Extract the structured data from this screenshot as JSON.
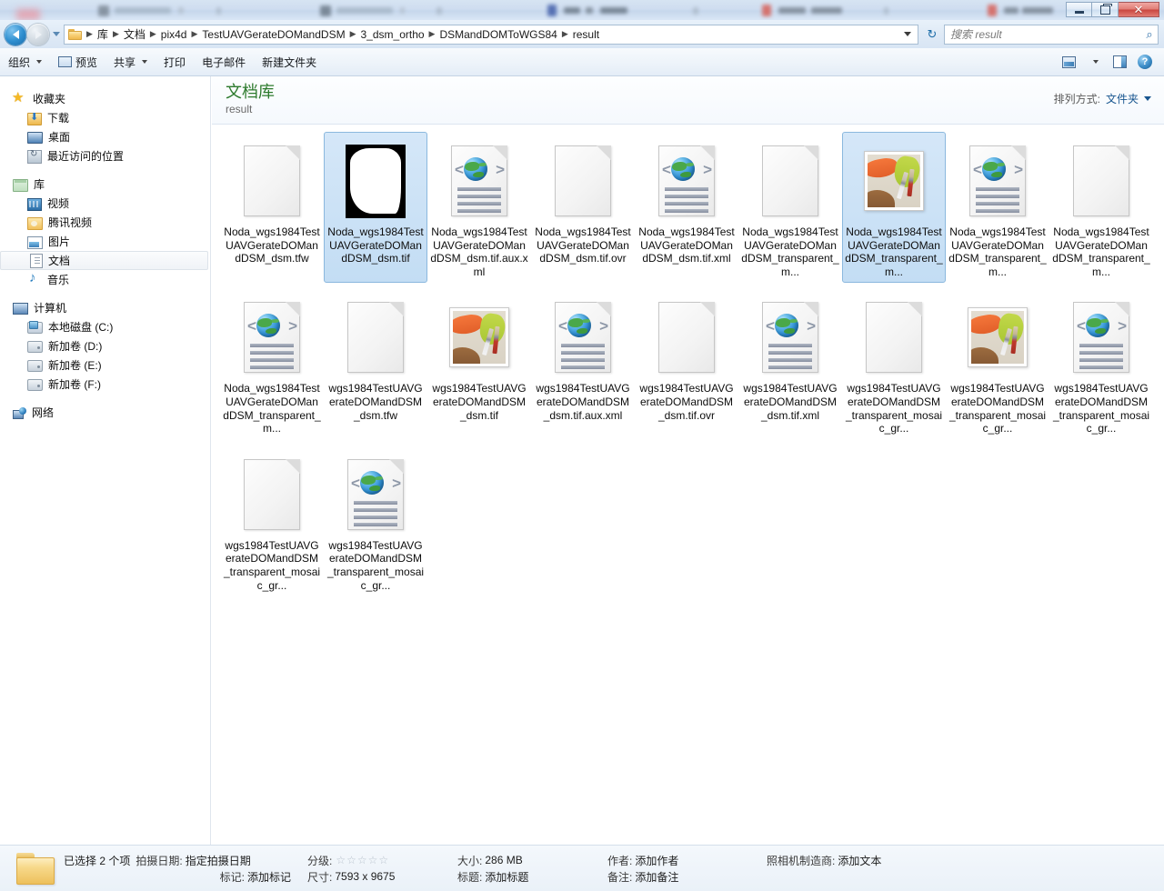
{
  "titlebar": {
    "minimize_label": "",
    "restore_label": "",
    "close_label": "✕"
  },
  "address_bar": {
    "back_icon": "back-arrow-icon",
    "forward_icon": "forward-arrow-icon",
    "recent_pages_icon": "chevron-down-icon",
    "breadcrumbs": [
      "库",
      "文档",
      "pix4d",
      "TestUAVGerateDOMandDSM",
      "3_dsm_ortho",
      "DSMandDOMToWGS84",
      "result"
    ],
    "dropdown_icon": "chevron-down-icon",
    "refresh_icon": "refresh-icon",
    "refresh_glyph": "↻",
    "search_placeholder": "搜索 result",
    "search_value": "",
    "search_icon": "search-icon",
    "search_glyph": "⌕"
  },
  "toolbar": {
    "items": [
      {
        "label": "组织",
        "has_caret": true,
        "icon": ""
      },
      {
        "label": "预览",
        "has_caret": false,
        "icon": "preview-icon"
      },
      {
        "label": "共享",
        "has_caret": true,
        "icon": ""
      },
      {
        "label": "打印",
        "has_caret": false,
        "icon": ""
      },
      {
        "label": "电子邮件",
        "has_caret": false,
        "icon": ""
      },
      {
        "label": "新建文件夹",
        "has_caret": false,
        "icon": ""
      }
    ],
    "right_buttons": [
      {
        "name": "change-view-button",
        "icon": "view-icon"
      },
      {
        "name": "change-view-dropdown",
        "icon": "chevron-down-icon"
      },
      {
        "name": "preview-pane-button",
        "icon": "preview-pane-icon"
      },
      {
        "name": "help-button",
        "icon": "help-icon",
        "glyph": "?"
      }
    ]
  },
  "sidebar": {
    "groups": [
      {
        "header": {
          "label": "收藏夹",
          "icon": "star-icon"
        },
        "items": [
          {
            "label": "下载",
            "icon": "download-icon"
          },
          {
            "label": "桌面",
            "icon": "desktop-icon"
          },
          {
            "label": "最近访问的位置",
            "icon": "recent-places-icon"
          }
        ]
      },
      {
        "header": {
          "label": "库",
          "icon": "library-icon"
        },
        "items": [
          {
            "label": "视频",
            "icon": "video-icon",
            "selected": false
          },
          {
            "label": "腾讯视频",
            "icon": "folder-icon",
            "selected": false
          },
          {
            "label": "图片",
            "icon": "pictures-icon",
            "selected": false
          },
          {
            "label": "文档",
            "icon": "documents-icon",
            "selected": true
          },
          {
            "label": "音乐",
            "icon": "music-icon",
            "selected": false
          }
        ]
      },
      {
        "header": {
          "label": "计算机",
          "icon": "computer-icon"
        },
        "items": [
          {
            "label": "本地磁盘 (C:)",
            "icon": "system-drive-icon"
          },
          {
            "label": "新加卷 (D:)",
            "icon": "drive-icon"
          },
          {
            "label": "新加卷 (E:)",
            "icon": "drive-icon"
          },
          {
            "label": "新加卷 (F:)",
            "icon": "drive-icon"
          }
        ]
      },
      {
        "header": {
          "label": "网络",
          "icon": "network-icon"
        },
        "items": []
      }
    ]
  },
  "library_header": {
    "title": "文档库",
    "subtitle": "result",
    "sort_label": "排列方式:",
    "sort_value": "文件夹",
    "sort_caret_icon": "chevron-down-icon"
  },
  "files": [
    {
      "name": "Noda_wgs1984TestUAVGerateDOMandDSM_dsm.tfw",
      "icon": "blank-file-icon",
      "selected": false
    },
    {
      "name": "Noda_wgs1984TestUAVGerateDOMandDSM_dsm.tif",
      "icon": "dsm-thumbnail-icon",
      "selected": true
    },
    {
      "name": "Noda_wgs1984TestUAVGerateDOMandDSM_dsm.tif.aux.xml",
      "icon": "xml-file-icon",
      "selected": false
    },
    {
      "name": "Noda_wgs1984TestUAVGerateDOMandDSM_dsm.tif.ovr",
      "icon": "blank-file-icon",
      "selected": false
    },
    {
      "name": "Noda_wgs1984TestUAVGerateDOMandDSM_dsm.tif.xml",
      "icon": "xml-file-icon",
      "selected": false
    },
    {
      "name": "Noda_wgs1984TestUAVGerateDOMandDSM_transparent_m...",
      "icon": "blank-file-icon",
      "selected": false
    },
    {
      "name": "Noda_wgs1984TestUAVGerateDOMandDSM_transparent_m...",
      "icon": "photo-thumbnail-icon",
      "selected": true
    },
    {
      "name": "Noda_wgs1984TestUAVGerateDOMandDSM_transparent_m...",
      "icon": "xml-file-icon",
      "selected": false
    },
    {
      "name": "Noda_wgs1984TestUAVGerateDOMandDSM_transparent_m...",
      "icon": "blank-file-icon",
      "selected": false
    },
    {
      "name": "Noda_wgs1984TestUAVGerateDOMandDSM_transparent_m...",
      "icon": "xml-file-icon",
      "selected": false
    },
    {
      "name": "wgs1984TestUAVGerateDOMandDSM_dsm.tfw",
      "icon": "blank-file-icon",
      "selected": false
    },
    {
      "name": "wgs1984TestUAVGerateDOMandDSM_dsm.tif",
      "icon": "photo-thumbnail-icon",
      "selected": false
    },
    {
      "name": "wgs1984TestUAVGerateDOMandDSM_dsm.tif.aux.xml",
      "icon": "xml-file-icon",
      "selected": false
    },
    {
      "name": "wgs1984TestUAVGerateDOMandDSM_dsm.tif.ovr",
      "icon": "blank-file-icon",
      "selected": false
    },
    {
      "name": "wgs1984TestUAVGerateDOMandDSM_dsm.tif.xml",
      "icon": "xml-file-icon",
      "selected": false
    },
    {
      "name": "wgs1984TestUAVGerateDOMandDSM_transparent_mosaic_gr...",
      "icon": "blank-file-icon",
      "selected": false
    },
    {
      "name": "wgs1984TestUAVGerateDOMandDSM_transparent_mosaic_gr...",
      "icon": "photo-thumbnail-icon",
      "selected": false
    },
    {
      "name": "wgs1984TestUAVGerateDOMandDSM_transparent_mosaic_gr...",
      "icon": "xml-file-icon",
      "selected": false
    },
    {
      "name": "wgs1984TestUAVGerateDOMandDSM_transparent_mosaic_gr...",
      "icon": "blank-file-icon",
      "selected": false
    },
    {
      "name": "wgs1984TestUAVGerateDOMandDSM_transparent_mosaic_gr...",
      "icon": "xml-file-icon",
      "selected": false
    }
  ],
  "status_bar": {
    "folder_icon": "folder-icon",
    "selection_text": "已选择 2 个项",
    "fields": [
      {
        "key": "拍摄日期:",
        "value": "指定拍摄日期"
      },
      {
        "key": "标记:",
        "value": "添加标记"
      },
      {
        "key": "分级:",
        "value": "",
        "stars": 5,
        "star_glyph": "☆"
      },
      {
        "key": "尺寸:",
        "value": "7593 x 9675"
      },
      {
        "key": "大小:",
        "value": "286 MB"
      },
      {
        "key": "标题:",
        "value": "添加标题"
      },
      {
        "key": "作者:",
        "value": "添加作者"
      },
      {
        "key": "备注:",
        "value": "添加备注"
      },
      {
        "key": "照相机制造商:",
        "value": "添加文本"
      }
    ]
  }
}
